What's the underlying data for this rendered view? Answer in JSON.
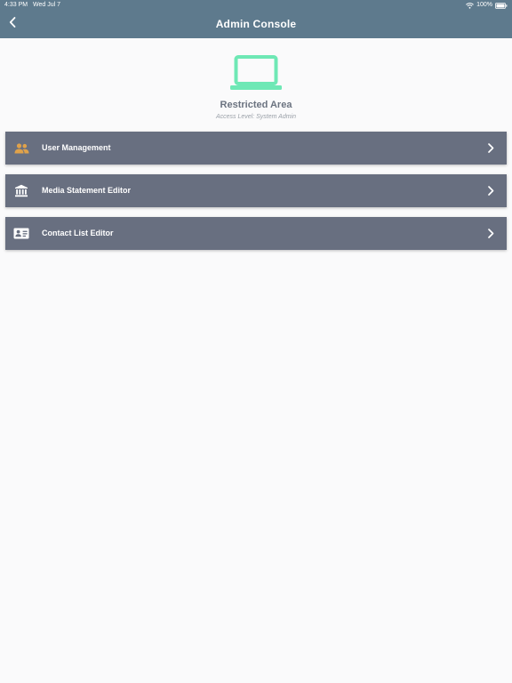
{
  "status_bar": {
    "time": "4:33 PM",
    "date": "Wed Jul 7",
    "battery": "100%"
  },
  "nav": {
    "title": "Admin Console",
    "back_icon": "chevron-left-icon"
  },
  "hero": {
    "icon": "laptop-icon",
    "title": "Restricted Area",
    "subtitle": "Access Level: System Admin"
  },
  "menu": {
    "items": [
      {
        "label": "User Management",
        "icon": "users-icon",
        "icon_color": "#e0a24a"
      },
      {
        "label": "Media Statement Editor",
        "icon": "bank-icon",
        "icon_color": "#ffffff"
      },
      {
        "label": "Contact List Editor",
        "icon": "contact-card-icon",
        "icon_color": "#ffffff"
      }
    ]
  },
  "colors": {
    "header": "#5e7a8d",
    "menu_item": "#686f80",
    "accent_green": "#6ee8b5",
    "background": "#fafafb"
  }
}
